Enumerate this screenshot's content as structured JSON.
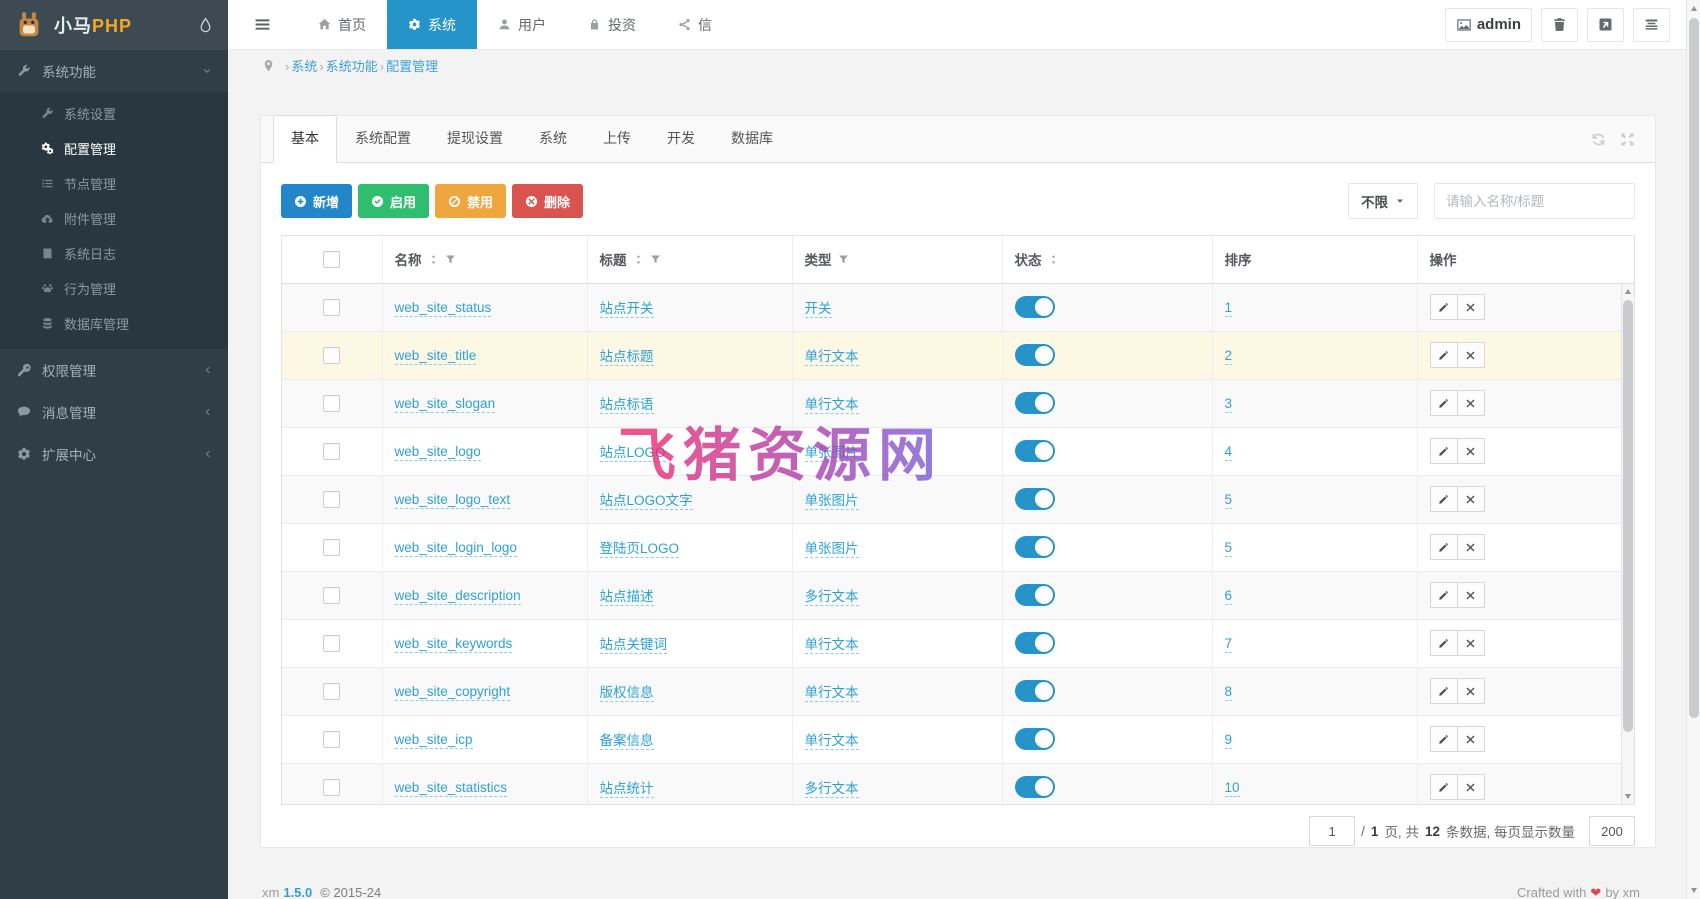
{
  "brand": {
    "mascot_icon": "horse-mascot",
    "name_cn": "小马",
    "name_php": "PHP",
    "drop_icon": "water-drop"
  },
  "header": {
    "hamburger_icon": "bars",
    "nav_items": [
      {
        "label": "首页",
        "icon": "home",
        "active": false
      },
      {
        "label": "系统",
        "icon": "gear",
        "active": true
      },
      {
        "label": "用户",
        "icon": "user",
        "active": false
      },
      {
        "label": "投资",
        "icon": "lock",
        "active": false
      },
      {
        "label": "信",
        "icon": "share-nodes",
        "active": false
      }
    ],
    "user": {
      "label": "admin",
      "icon": "broken-image"
    },
    "actions": [
      {
        "name": "trash-button",
        "icon": "trash"
      },
      {
        "name": "external-link-button",
        "icon": "external-link"
      },
      {
        "name": "menu-rows-button",
        "icon": "list-rows"
      }
    ]
  },
  "breadcrumb": {
    "pin_icon": "map-pin",
    "separator": "›",
    "items": [
      "系统",
      "系统功能",
      "配置管理"
    ]
  },
  "sidebar": {
    "sections": [
      {
        "label": "系统功能",
        "icon": "wrench",
        "expanded": true,
        "children": [
          {
            "label": "系统设置",
            "icon": "wrench",
            "active": false
          },
          {
            "label": "配置管理",
            "icon": "cogs",
            "active": true
          },
          {
            "label": "节点管理",
            "icon": "list",
            "active": false
          },
          {
            "label": "附件管理",
            "icon": "cloud-upload",
            "active": false
          },
          {
            "label": "系统日志",
            "icon": "book",
            "active": false
          },
          {
            "label": "行为管理",
            "icon": "paw",
            "active": false
          },
          {
            "label": "数据库管理",
            "icon": "database",
            "active": false
          }
        ]
      },
      {
        "label": "权限管理",
        "icon": "key",
        "expanded": false
      },
      {
        "label": "消息管理",
        "icon": "comment",
        "expanded": false
      },
      {
        "label": "扩展中心",
        "icon": "gear",
        "expanded": false
      }
    ]
  },
  "tabs": {
    "active": "基本",
    "items": [
      "基本",
      "系统配置",
      "提现设置",
      "系统",
      "上传",
      "开发",
      "数据库"
    ],
    "tools": [
      {
        "name": "refresh-button",
        "icon": "refresh"
      },
      {
        "name": "fullscreen-button",
        "icon": "expand"
      }
    ]
  },
  "toolbar": {
    "buttons": [
      {
        "label": "新增",
        "icon": "plus-circle",
        "color": "#2386c8"
      },
      {
        "label": "启用",
        "icon": "check-circle",
        "color": "#2fbd6f"
      },
      {
        "label": "禁用",
        "icon": "ban-circle",
        "color": "#f0a63e"
      },
      {
        "label": "删除",
        "icon": "times-circle",
        "color": "#d9534f"
      }
    ],
    "filter_dropdown": {
      "label": "不限",
      "caret_icon": "caret-down"
    },
    "search": {
      "placeholder": "请输入名称/标题",
      "value": ""
    }
  },
  "table": {
    "columns": [
      {
        "label": "",
        "checkbox": true,
        "sort": false,
        "filter": false
      },
      {
        "label": "名称",
        "sort": true,
        "filter": true
      },
      {
        "label": "标题",
        "sort": true,
        "filter": true
      },
      {
        "label": "类型",
        "sort": false,
        "filter": true
      },
      {
        "label": "状态",
        "sort": true,
        "filter": false
      },
      {
        "label": "排序",
        "sort": false,
        "filter": false
      },
      {
        "label": "操作",
        "sort": false,
        "filter": false
      }
    ],
    "row_actions": [
      {
        "name": "edit-button",
        "icon": "pencil"
      },
      {
        "name": "delete-button",
        "icon": "times"
      }
    ],
    "rows": [
      {
        "name": "web_site_status",
        "title": "站点开关",
        "type": "开关",
        "status": "on",
        "sort": "1",
        "highlight": false
      },
      {
        "name": "web_site_title",
        "title": "站点标题",
        "type": "单行文本",
        "status": "on",
        "sort": "2",
        "highlight": true
      },
      {
        "name": "web_site_slogan",
        "title": "站点标语",
        "type": "单行文本",
        "status": "on",
        "sort": "3",
        "highlight": false
      },
      {
        "name": "web_site_logo",
        "title": "站点LOGO",
        "type": "单张图片",
        "status": "on",
        "sort": "4",
        "highlight": false
      },
      {
        "name": "web_site_logo_text",
        "title": "站点LOGO文字",
        "type": "单张图片",
        "status": "on",
        "sort": "5",
        "highlight": false
      },
      {
        "name": "web_site_login_logo",
        "title": "登陆页LOGO",
        "type": "单张图片",
        "status": "on",
        "sort": "5",
        "highlight": false
      },
      {
        "name": "web_site_description",
        "title": "站点描述",
        "type": "多行文本",
        "status": "on",
        "sort": "6",
        "highlight": false
      },
      {
        "name": "web_site_keywords",
        "title": "站点关键词",
        "type": "单行文本",
        "status": "on",
        "sort": "7",
        "highlight": false
      },
      {
        "name": "web_site_copyright",
        "title": "版权信息",
        "type": "单行文本",
        "status": "on",
        "sort": "8",
        "highlight": false
      },
      {
        "name": "web_site_icp",
        "title": "备案信息",
        "type": "单行文本",
        "status": "on",
        "sort": "9",
        "highlight": false
      },
      {
        "name": "web_site_statistics",
        "title": "站点统计",
        "type": "多行文本",
        "status": "on",
        "sort": "10",
        "highlight": false
      }
    ]
  },
  "pagination": {
    "page": "1",
    "separator": "/",
    "total_pages": "1",
    "pages_label": "页, 共",
    "total_records": "12",
    "records_label": "条数据, 每页显示数量",
    "page_size": "200"
  },
  "watermark": {
    "text": "飞猪资源网",
    "gradient": [
      "#ef2a6f",
      "#8a5bd0"
    ]
  },
  "footer": {
    "left_app": "xm",
    "left_version": "1.5.0",
    "left_copyright": "© 2015-24",
    "right_prefix": "Crafted with",
    "heart": "❤",
    "right_suffix": "by xm"
  },
  "colors": {
    "topnav_active": "#2494c9",
    "link_blue": "#2da1d8",
    "toggle_on": "#2693c9",
    "row_highlight": "#fcf8e3",
    "sidebar_bg": "#2f3e47",
    "logo_php_orange": "#f5a623"
  }
}
